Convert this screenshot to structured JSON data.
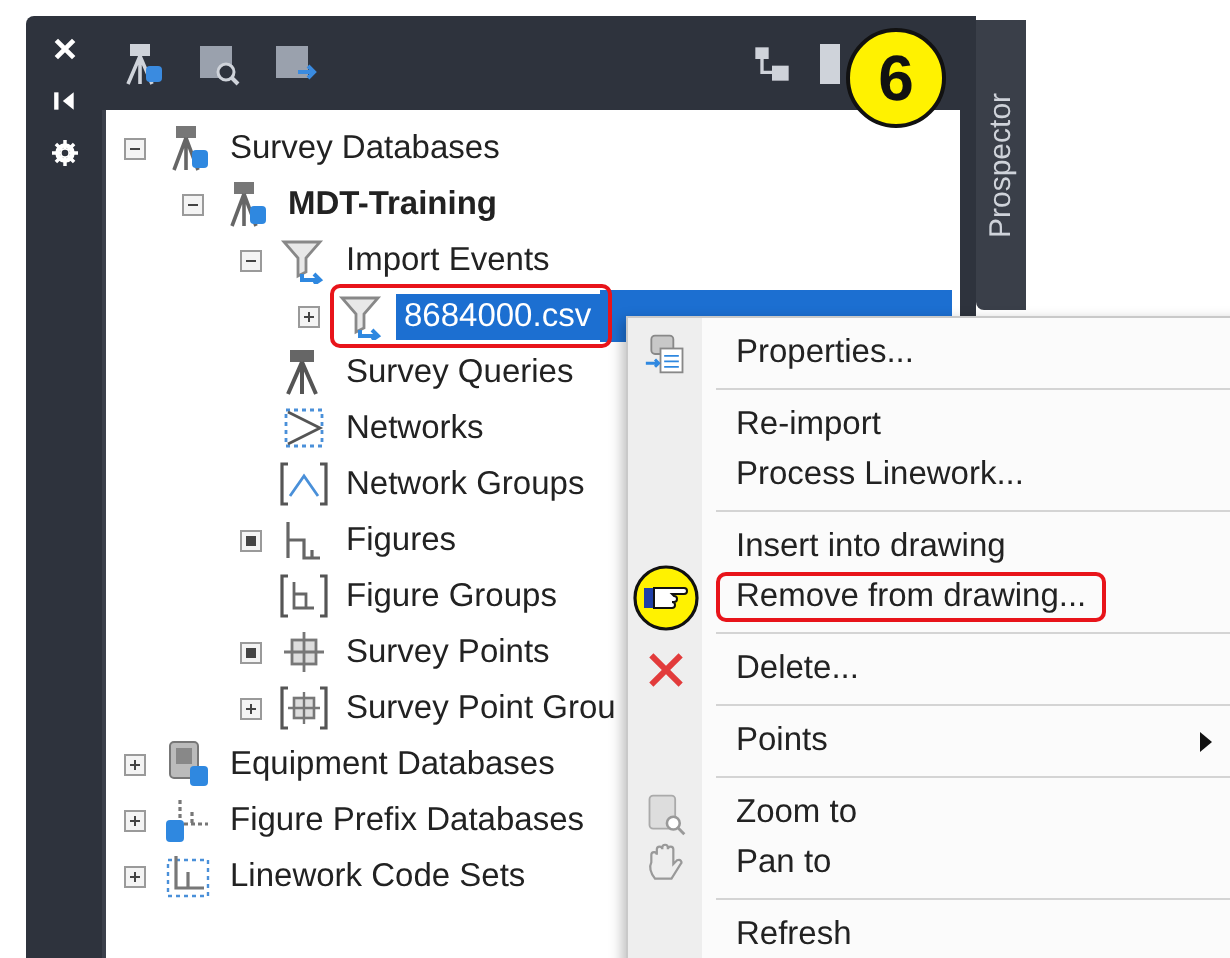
{
  "step_badge": "6",
  "side_tab": "Prospector",
  "tree": [
    {
      "label": "Survey Databases",
      "kind": "survey-db",
      "expander": {
        "kind": "toggle",
        "expanded": true
      },
      "bold": false,
      "selected": false,
      "annotated": false,
      "children": [
        {
          "label": "MDT-Training",
          "kind": "survey-db",
          "expander": {
            "kind": "toggle",
            "expanded": true
          },
          "bold": true,
          "selected": false,
          "annotated": false,
          "children": [
            {
              "label": "Import Events",
              "kind": "import",
              "expander": {
                "kind": "toggle",
                "expanded": true
              },
              "bold": false,
              "selected": false,
              "annotated": false,
              "children": [
                {
                  "label": "8684000.csv",
                  "kind": "import",
                  "expander": {
                    "kind": "toggle",
                    "expanded": false
                  },
                  "bold": false,
                  "selected": true,
                  "annotated": true
                }
              ]
            },
            {
              "label": "Survey Queries",
              "kind": "query",
              "bold": false,
              "selected": false,
              "annotated": false
            },
            {
              "label": "Networks",
              "kind": "network",
              "bold": false,
              "selected": false,
              "annotated": false
            },
            {
              "label": "Network Groups",
              "kind": "network-group",
              "bold": false,
              "selected": false,
              "annotated": false
            },
            {
              "label": "Figures",
              "kind": "figures",
              "expander": {
                "kind": "dot"
              },
              "bold": false,
              "selected": false,
              "annotated": false
            },
            {
              "label": "Figure Groups",
              "kind": "figure-group",
              "bold": false,
              "selected": false,
              "annotated": false
            },
            {
              "label": "Survey Points",
              "kind": "points",
              "expander": {
                "kind": "dot"
              },
              "bold": false,
              "selected": false,
              "annotated": false
            },
            {
              "label": "Survey Point Grou",
              "kind": "point-group",
              "expander": {
                "kind": "toggle",
                "expanded": false
              },
              "bold": false,
              "selected": false,
              "annotated": false
            }
          ]
        }
      ]
    },
    {
      "label": "Equipment Databases",
      "kind": "equipment",
      "expander": {
        "kind": "toggle",
        "expanded": false
      },
      "bold": false,
      "selected": false,
      "annotated": false
    },
    {
      "label": "Figure Prefix Databases",
      "kind": "prefix",
      "expander": {
        "kind": "toggle",
        "expanded": false
      },
      "bold": false,
      "selected": false,
      "annotated": false
    },
    {
      "label": "Linework Code Sets",
      "kind": "linework",
      "expander": {
        "kind": "toggle",
        "expanded": false
      },
      "bold": false,
      "selected": false,
      "annotated": false
    }
  ],
  "context_menu": [
    [
      {
        "label": "Properties...",
        "kind": "properties",
        "annotated": false
      }
    ],
    [
      {
        "label": "Re-import",
        "annotated": false
      },
      {
        "label": "Process Linework...",
        "annotated": false
      }
    ],
    [
      {
        "label": "Insert into drawing",
        "annotated": false
      },
      {
        "label": "Remove from drawing...",
        "kind": "pointer",
        "annotated": true
      }
    ],
    [
      {
        "label": "Delete...",
        "kind": "delete",
        "annotated": false
      }
    ],
    [
      {
        "label": "Points",
        "kind": "submenu",
        "annotated": false
      }
    ],
    [
      {
        "label": "Zoom to",
        "kind": "zoom",
        "annotated": false
      },
      {
        "label": "Pan to",
        "kind": "pan",
        "annotated": false
      }
    ],
    [
      {
        "label": "Refresh",
        "annotated": false
      }
    ]
  ]
}
